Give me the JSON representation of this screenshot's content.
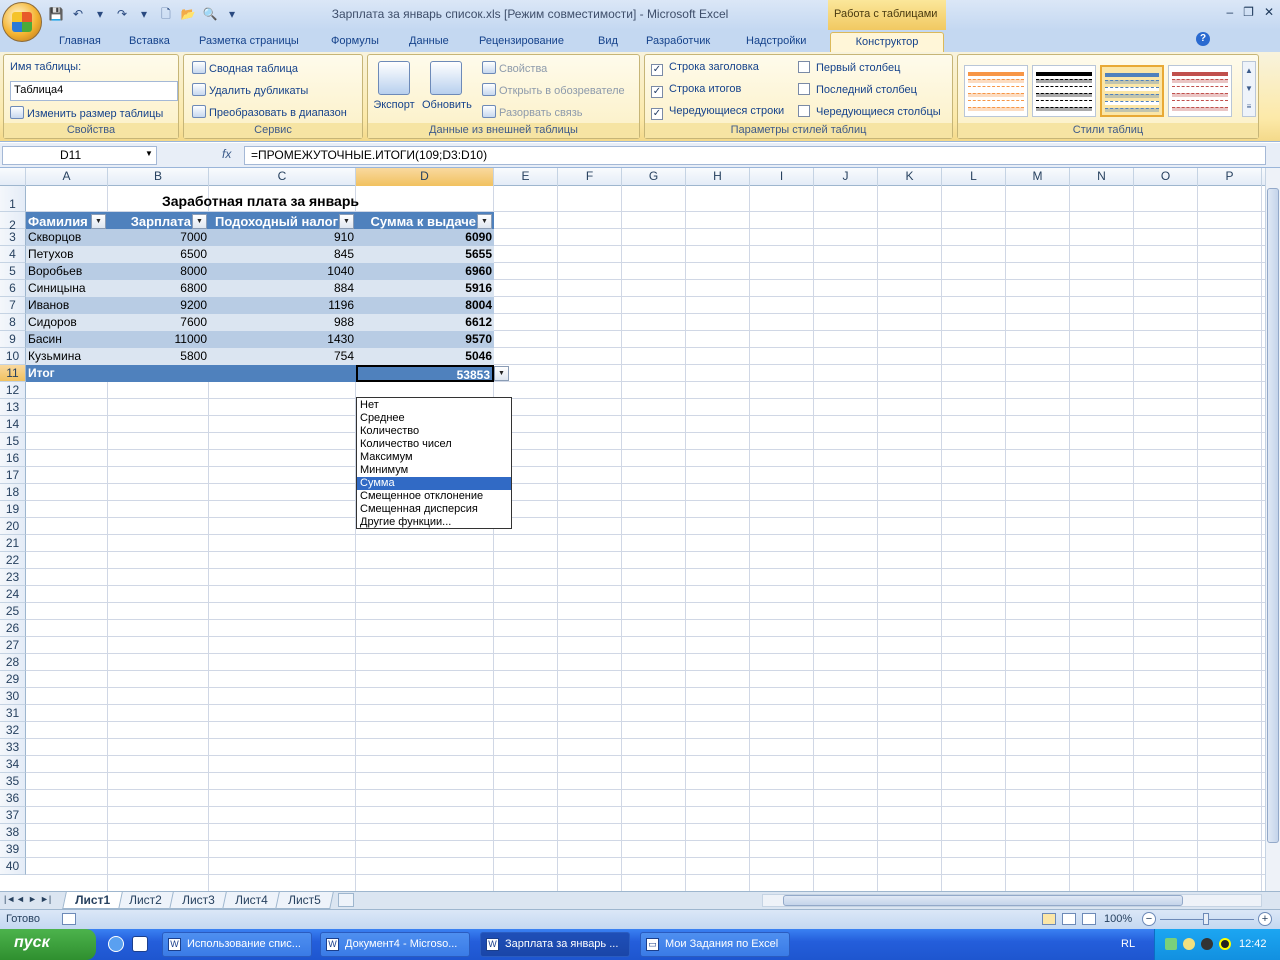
{
  "window": {
    "title": "Зарплата за январь список.xls  [Режим совместимости] - Microsoft Excel",
    "context_title": "Работа с таблицами"
  },
  "quick_access": [
    "💾",
    "↶",
    "▾",
    "↷",
    "▾",
    "🗋",
    "📂",
    "🔍",
    "▾"
  ],
  "window_controls": {
    "minimize": "–",
    "restore": "❐",
    "close": "✕"
  },
  "tabs": [
    "Главная",
    "Вставка",
    "Разметка страницы",
    "Формулы",
    "Данные",
    "Рецензирование",
    "Вид",
    "Разработчик",
    "Надстройки",
    "Конструктор"
  ],
  "ribbon_help": "?",
  "ribbon": {
    "properties": {
      "label": "Свойства",
      "name_label": "Имя таблицы:",
      "name_value": "Таблица4",
      "resize": "Изменить размер таблицы"
    },
    "service": {
      "label": "Сервис",
      "pivot": "Сводная таблица",
      "remove_dup": "Удалить дубликаты",
      "convert": "Преобразовать в диапазон"
    },
    "external": {
      "label": "Данные из внешней таблицы",
      "export": "Экспорт",
      "refresh": "Обновить",
      "props": "Свойства",
      "open_browser": "Открыть в обозревателе",
      "unlink": "Разорвать связь"
    },
    "style_options": {
      "label": "Параметры стилей таблиц",
      "header_row": "Строка заголовка",
      "total_row": "Строка итогов",
      "banded_rows": "Чередующиеся строки",
      "first_col": "Первый столбец",
      "last_col": "Последний столбец",
      "banded_cols": "Чередующиеся столбцы",
      "header_row_checked": true,
      "total_row_checked": true,
      "banded_rows_checked": true
    },
    "styles": {
      "label": "Стили таблиц",
      "swatches": [
        "#f79646",
        "#000000",
        "#4f81bd",
        "#c0504d"
      ],
      "selected": 2
    }
  },
  "formula_bar": {
    "cell": "D11",
    "fx": "fx",
    "formula": "=ПРОМЕЖУТОЧНЫЕ.ИТОГИ(109;D3:D10)"
  },
  "columns": [
    "A",
    "B",
    "C",
    "D",
    "E",
    "F",
    "G",
    "H",
    "I",
    "J",
    "K",
    "L",
    "M",
    "N",
    "O",
    "P"
  ],
  "sheet": {
    "title": "Заработная плата за январь",
    "headers": [
      "Фамилия",
      "Зарплата",
      "Подоходный налог",
      "Сумма к выдаче"
    ],
    "rows": [
      [
        "Скворцов",
        "7000",
        "910",
        "6090"
      ],
      [
        "Петухов",
        "6500",
        "845",
        "5655"
      ],
      [
        "Воробьев",
        "8000",
        "1040",
        "6960"
      ],
      [
        "Синицына",
        "6800",
        "884",
        "5916"
      ],
      [
        "Иванов",
        "9200",
        "1196",
        "8004"
      ],
      [
        "Сидоров",
        "7600",
        "988",
        "6612"
      ],
      [
        "Басин",
        "11000",
        "1430",
        "9570"
      ],
      [
        "Кузьмина",
        "5800",
        "754",
        "5046"
      ]
    ],
    "total_label": "Итог",
    "total_value": "53853"
  },
  "dropdown": {
    "items": [
      "Нет",
      "Среднее",
      "Количество",
      "Количество чисел",
      "Максимум",
      "Минимум",
      "Сумма",
      "Смещенное отклонение",
      "Смещенная дисперсия",
      "Другие функции..."
    ],
    "selected": "Сумма"
  },
  "sheet_tabs": [
    "Лист1",
    "Лист2",
    "Лист3",
    "Лист4",
    "Лист5"
  ],
  "sheet_nav": [
    "|◄",
    "◄",
    "►",
    "►|"
  ],
  "status": {
    "ready": "Готово",
    "zoom": "100%",
    "zoom_minus": "−",
    "zoom_plus": "+"
  },
  "taskbar": {
    "start": "пуск",
    "tasks": [
      "Использование спис...",
      "Документ4 - Microso...",
      "Зарплата за январь ...",
      "Мои Задания по Excel"
    ],
    "lang": "RL",
    "clock": "12:42"
  }
}
